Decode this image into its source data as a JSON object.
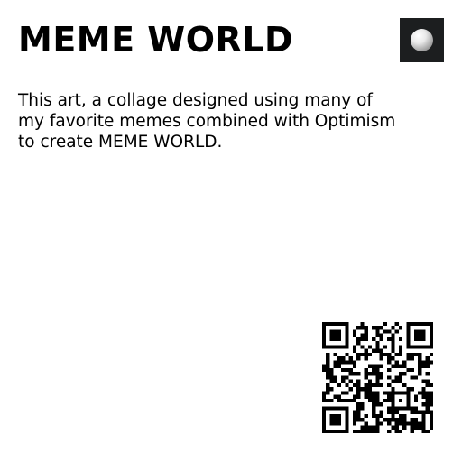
{
  "title": "MEME WORLD",
  "description": "This art, a collage designed using many of my favorite memes combined with Optimism to create MEME WORLD.",
  "thumbnail": {
    "icon": "sphere-icon"
  },
  "qr": {
    "icon": "qr-code-icon"
  },
  "colors": {
    "text": "#000000",
    "background": "#ffffff",
    "thumbnail_bg": "#1c1e1f"
  }
}
